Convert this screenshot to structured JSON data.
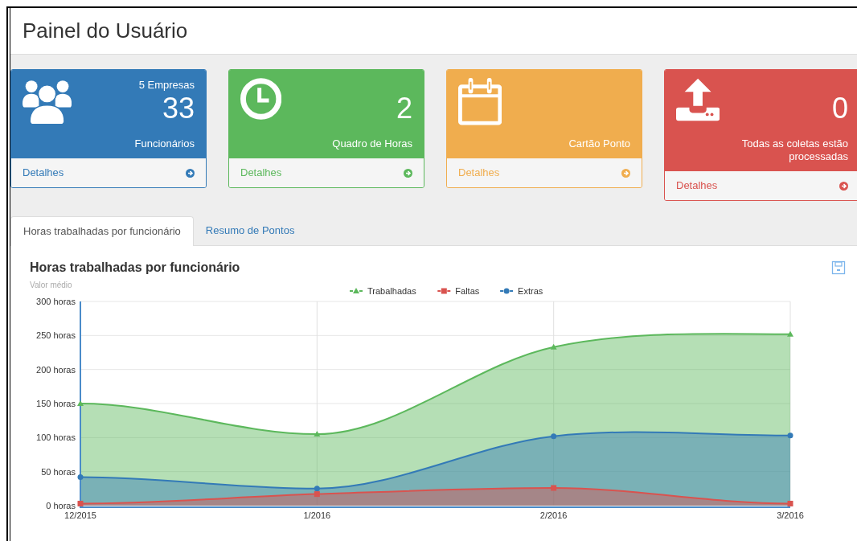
{
  "header": {
    "title": "Painel do Usuário"
  },
  "cards": [
    {
      "kind": "people",
      "color": "#337ab7",
      "caption": "5 Empresas",
      "count": "33",
      "label": "Funcionários",
      "link": "Detalhes"
    },
    {
      "kind": "clock",
      "color": "#5cb85c",
      "count": "2",
      "label": "Quadro de Horas",
      "link": "Detalhes"
    },
    {
      "kind": "calendar",
      "color": "#f0ad4e",
      "label": "Cartão Ponto",
      "link": "Detalhes"
    },
    {
      "kind": "upload",
      "color": "#d9534f",
      "count": "0",
      "label": "Todas as coletas estão processadas",
      "link": "Detalhes"
    }
  ],
  "tabs": [
    {
      "label": "Horas trabalhadas por funcionário",
      "selected": true
    },
    {
      "label": "Resumo de Pontos",
      "selected": false
    }
  ],
  "chart_panel": {
    "chart_data": {
      "type": "area",
      "title": "Horas trabalhadas por funcionário",
      "ylabel": "Valor médio",
      "categories": [
        "12/2015",
        "1/2016",
        "2/2016",
        "3/2016"
      ],
      "series": [
        {
          "name": "Trabalhadas",
          "color": "#5cb85c",
          "values": [
            150,
            105,
            233,
            252
          ]
        },
        {
          "name": "Faltas",
          "color": "#d9534f",
          "values": [
            3,
            17,
            26,
            3
          ]
        },
        {
          "name": "Extras",
          "color": "#337ab7",
          "values": [
            42,
            25,
            102,
            103
          ]
        }
      ],
      "ylim": [
        0,
        300
      ],
      "grid": true,
      "legend": "top",
      "yticks": [
        {
          "value": 0,
          "label": "0 horas"
        },
        {
          "value": 50,
          "label": "50 horas"
        },
        {
          "value": 100,
          "label": "100 horas"
        },
        {
          "value": 150,
          "label": "150 horas"
        },
        {
          "value": 200,
          "label": "200 horas"
        },
        {
          "value": 250,
          "label": "250 horas"
        },
        {
          "value": 300,
          "label": "300 horas"
        }
      ]
    }
  }
}
